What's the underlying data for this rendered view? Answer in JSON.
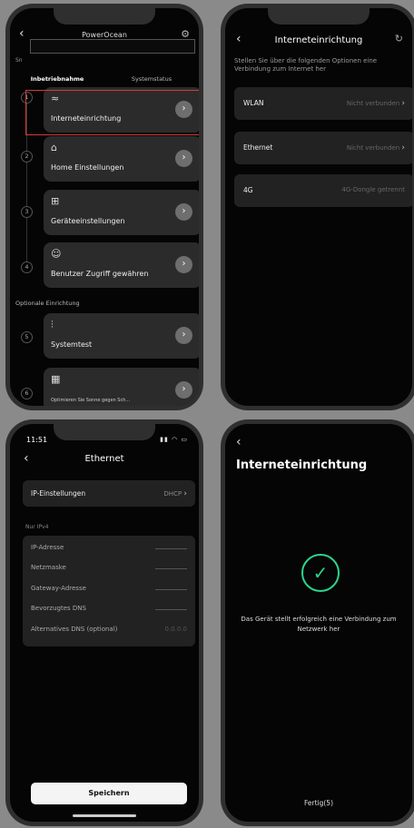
{
  "screen1": {
    "title": "PowerOcean",
    "sn_label": "Sn",
    "tabs": [
      {
        "label": "Inbetriebnahme",
        "active": true
      },
      {
        "label": "Systemstatus",
        "active": false
      }
    ],
    "steps": [
      {
        "number": "1",
        "label": "Interneteinrichtung",
        "icon": "wifi-icon"
      },
      {
        "number": "2",
        "label": "Home Einstellungen",
        "icon": "home-icon"
      },
      {
        "number": "3",
        "label": "Geräteeinstellungen",
        "icon": "devices-icon"
      },
      {
        "number": "4",
        "label": "Benutzer Zugriff gewähren",
        "icon": "user-icon"
      }
    ],
    "optional_label": "Optionale Einrichtung",
    "optional_steps": [
      {
        "number": "5",
        "label": "Systemtest",
        "icon": "sliders-icon"
      },
      {
        "number": "6",
        "label": "Optimieren Sie Sonne gegen Sch...",
        "icon": "building-icon"
      }
    ],
    "highlight_color": "#d23b3b"
  },
  "screen2": {
    "title": "Interneteinrichtung",
    "description": "Stellen Sie über die folgenden Optionen eine Verbindung zum Internet her",
    "options": [
      {
        "label": "WLAN",
        "status": "Nicht verbunden",
        "chevron": true
      },
      {
        "label": "Ethernet",
        "status": "Nicht verbunden",
        "chevron": true
      },
      {
        "label": "4G",
        "status": "4G-Dongle getrennt",
        "chevron": false
      }
    ]
  },
  "screen3": {
    "time": "11:51",
    "title": "Ethernet",
    "ip_settings_label": "IP-Einstellungen",
    "ip_settings_value": "DHCP",
    "ipv4_label": "Nur IPv4",
    "fields": [
      {
        "label": "IP-Adresse",
        "value": ""
      },
      {
        "label": "Netzmaske",
        "value": ""
      },
      {
        "label": "Gateway-Adresse",
        "value": ""
      },
      {
        "label": "Bevorzugtes DNS",
        "value": ""
      },
      {
        "label": "Alternatives DNS (optional)",
        "value": "0.0.0.0"
      }
    ],
    "save_label": "Speichern"
  },
  "screen4": {
    "title": "Interneteinrichtung",
    "message": "Das Gerät stellt erfolgreich eine Verbindung zum Netzwerk her",
    "done_label": "Fertig(5)",
    "success_color": "#2bd48c"
  }
}
